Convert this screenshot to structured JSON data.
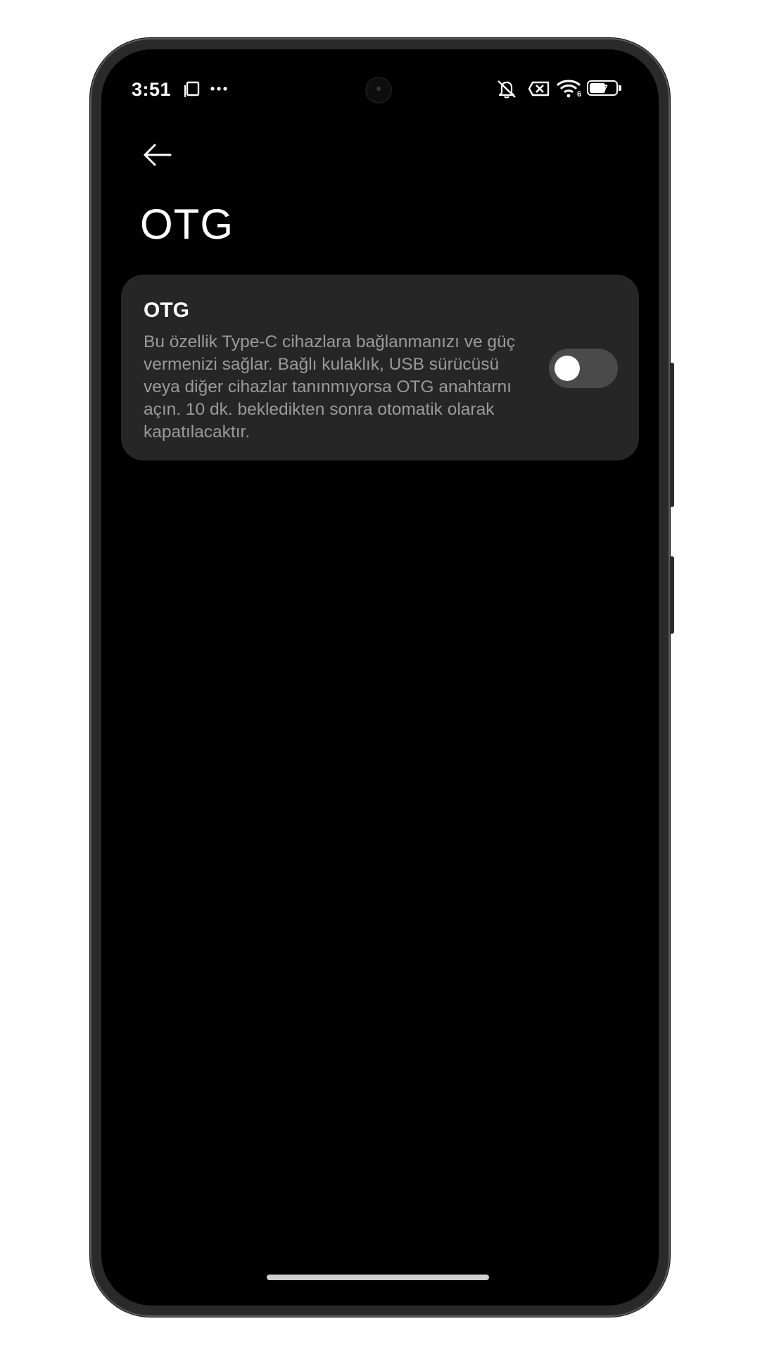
{
  "statusbar": {
    "time": "3:51",
    "icons": [
      "screenshot-icon",
      "more-dots-icon",
      "mute-bell-icon",
      "sim-error-icon",
      "wifi-icon",
      "battery-icon"
    ],
    "wifi_badge": "6",
    "battery_level": "57"
  },
  "header": {
    "back_icon": "arrow-left-icon",
    "title": "OTG"
  },
  "otg_setting": {
    "title": "OTG",
    "description": "Bu özellik Type-C cihazlara bağlanmanızı ve güç vermenizi sağlar. Bağlı kulaklık, USB sürücüsü veya diğer cihazlar tanınmıyorsa OTG anahtarnı açın. 10 dk. bekledikten sonra otomatik olarak kapatılacaktır.",
    "toggle_state": "off"
  },
  "colors": {
    "background": "#000000",
    "card": "#262626",
    "toggle_off_track": "#4a4a4a",
    "text_primary": "#ffffff",
    "text_secondary": "#9a9a9a"
  }
}
